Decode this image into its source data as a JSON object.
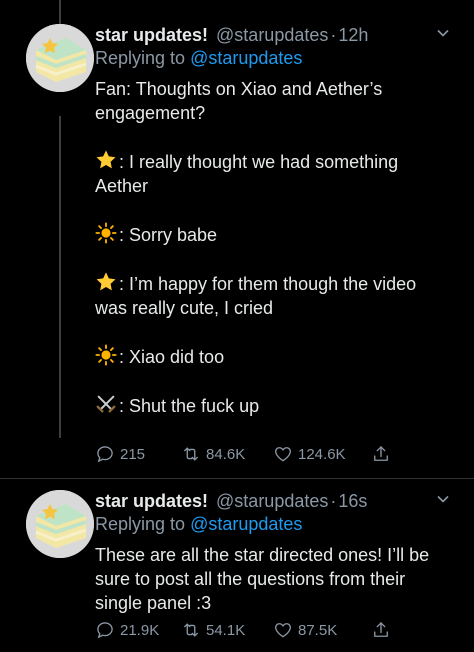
{
  "tweets": [
    {
      "name": "star updates!",
      "handle": "@starupdates",
      "dot": "·",
      "time": "12h",
      "reply_prefix": "Replying to",
      "reply_to": "@starupdates",
      "paragraphs": [
        {
          "emoji": "",
          "text": "Fan: Thoughts on Xiao and Aether’s engagement?"
        },
        {
          "emoji": "star-emoji",
          "text": ": I really thought we had something Aether"
        },
        {
          "emoji": "sun-emoji",
          "text": ": Sorry babe"
        },
        {
          "emoji": "star-emoji",
          "text": ": I’m happy for them though the video was really cute, I cried"
        },
        {
          "emoji": "sun-emoji",
          "text": ": Xiao did too"
        },
        {
          "emoji": "swords-emoji",
          "text": ": Shut the fuck up"
        }
      ],
      "actions": {
        "replies": "215",
        "retweets": "84.6K",
        "likes": "124.6K"
      }
    },
    {
      "name": "star updates!",
      "handle": "@starupdates",
      "dot": "·",
      "time": "16s",
      "reply_prefix": "Replying to",
      "reply_to": "@starupdates",
      "paragraphs": [
        {
          "emoji": "",
          "text": "These are all the star directed ones! I’ll be sure to post all the questions from their single panel :3"
        }
      ],
      "actions": {
        "replies": "21.9K",
        "retweets": "54.1K",
        "likes": "87.5K"
      }
    }
  ],
  "colors": {
    "background": "#000000",
    "text": "#e7e9ea",
    "muted": "#8b98a5",
    "link": "#1d9bf0",
    "avatar_cake": "#f3e7a6",
    "avatar_frosting": "#bfe3c6"
  }
}
